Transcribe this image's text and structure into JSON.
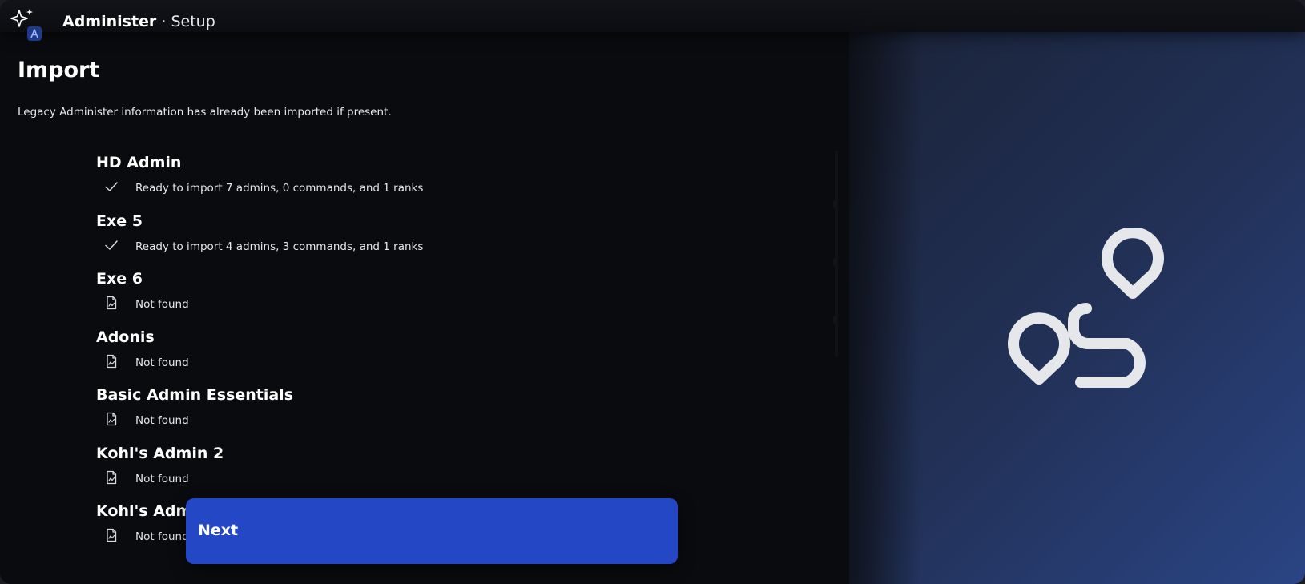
{
  "app": {
    "name": "Administer",
    "separator": "·",
    "section": "Setup",
    "icon": "sparkle-app-icon"
  },
  "page": {
    "title": "Import",
    "description": "Legacy Administer information has already been imported if present."
  },
  "import_sources": [
    {
      "name": "HD Admin",
      "status": "Ready to import 7 admins, 0 commands, and 1 ranks",
      "icon": "checkmark-icon"
    },
    {
      "name": "Exe 5",
      "status": "Ready to import 4 admins, 3 commands, and 1 ranks",
      "icon": "checkmark-icon"
    },
    {
      "name": "Exe 6",
      "status": "Not found",
      "icon": "file-missing-icon"
    },
    {
      "name": "Adonis",
      "status": "Not found",
      "icon": "file-missing-icon"
    },
    {
      "name": "Basic Admin Essentials",
      "status": "Not found",
      "icon": "file-missing-icon"
    },
    {
      "name": "Kohl's Admin 2",
      "status": "Not found",
      "icon": "file-missing-icon"
    },
    {
      "name": "Kohl's Admi",
      "status": "Not found",
      "icon": "file-missing-icon"
    }
  ],
  "next_button": {
    "label": "Next"
  },
  "colors": {
    "accent": "#2447c6",
    "background": "#0a0b0e",
    "panel_gradient_end": "#2a4585"
  }
}
